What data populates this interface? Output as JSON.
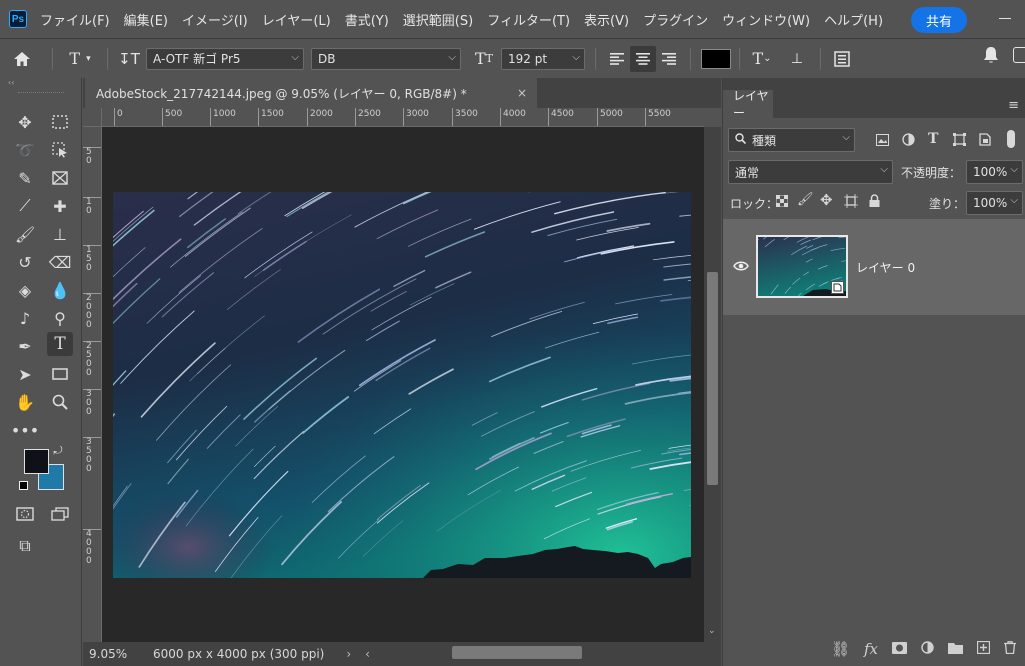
{
  "app": {
    "logo": "Ps"
  },
  "menu": [
    "ファイル(F)",
    "編集(E)",
    "イメージ(I)",
    "レイヤー(L)",
    "書式(Y)",
    "選択範囲(S)",
    "フィルター(T)",
    "表示(V)",
    "プラグイン",
    "ウィンドウ(W)",
    "ヘルプ(H)"
  ],
  "options": {
    "font_family": "A-OTF 新ゴ Pr5",
    "font_style": "DB",
    "font_size": "192 pt",
    "share_label": "共有",
    "text_color": "#000000"
  },
  "document": {
    "tab_title": "AdobeStock_217742144.jpeg @ 9.05% (レイヤー 0, RGB/8#) *",
    "ruler_h": [
      "0",
      "500",
      "1000",
      "1500",
      "2000",
      "2500",
      "3000",
      "3500",
      "4000",
      "4500",
      "5000",
      "5500"
    ],
    "ruler_v": [
      "5\n0",
      "1\n0",
      "1\n5\n0",
      "2\n0\n0\n0",
      "2\n5\n0\n0",
      "3\n0\n0",
      "3\n5\n0\n0",
      "4\n0\n0\n0"
    ],
    "zoom": "9.05%",
    "doc_info": "6000 px x 4000 px (300 ppi)"
  },
  "tools": {
    "foreground_color": "#101018",
    "background_color": "#1f7aa8"
  },
  "layers_panel": {
    "title": "レイヤー",
    "filter_kind": "種類",
    "blend_mode": "通常",
    "opacity_label": "不透明度：",
    "opacity_value": "100%",
    "lock_label": "ロック：",
    "fill_label": "塗り：",
    "fill_value": "100%",
    "layers": [
      {
        "name": "レイヤー 0",
        "visible": true
      }
    ]
  },
  "colors": {
    "accent": "#1473e6",
    "ui_bg": "#535353",
    "canvas_bg": "#282828"
  }
}
